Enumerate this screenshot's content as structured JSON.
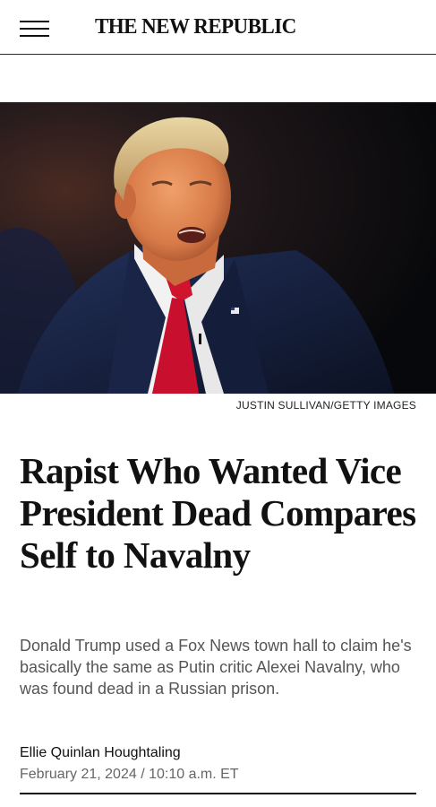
{
  "header": {
    "menu_icon": "hamburger-menu-icon",
    "logo_text": "THE NEW REPUBLIC"
  },
  "hero": {
    "credit": "JUSTIN SULLIVAN/GETTY IMAGES"
  },
  "article": {
    "headline": "Rapist Who Wanted Vice President Dead Compares Self to Navalny",
    "dek": "Donald Trump used a Fox News town hall to claim he's basically the same as Putin critic Alexei Navalny, who was found dead in a Russian prison.",
    "author": "Ellie Quinlan Houghtaling",
    "date": "February 21, 2024 / 10:10 a.m. ET"
  },
  "colors": {
    "tie": "#c8102e",
    "suit": "#17213b",
    "background_dark": "#0b0c10"
  }
}
